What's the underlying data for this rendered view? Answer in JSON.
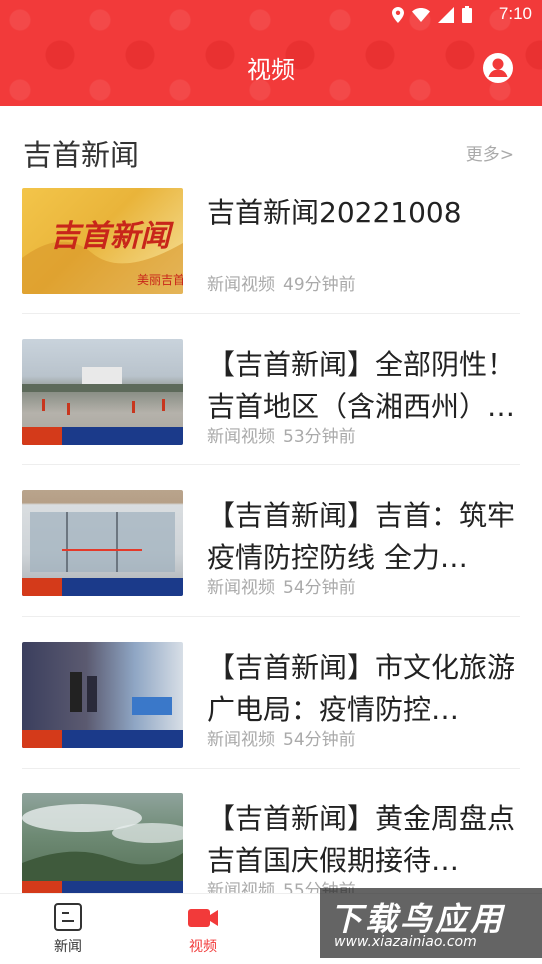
{
  "status_bar": {
    "time": "7:10"
  },
  "header": {
    "title": "视频"
  },
  "section": {
    "title": "吉首新闻",
    "more": "更多>"
  },
  "colors": {
    "accent": "#f23a3a",
    "muted": "#aaaaaa"
  },
  "news": [
    {
      "title": "吉首新闻20221008",
      "source": "新闻视频",
      "time": "49分钟前",
      "thumb": "news-logo-thumbnail"
    },
    {
      "title": "【吉首新闻】全部阴性！吉首地区（含湘西州）…",
      "source": "新闻视频",
      "time": "53分钟前",
      "thumb": "square-crowd-thumbnail"
    },
    {
      "title": "【吉首新闻】吉首：筑牢疫情防控防线 全力…",
      "source": "新闻视频",
      "time": "54分钟前",
      "thumb": "station-entrance-thumbnail"
    },
    {
      "title": "【吉首新闻】市文化旅游广电局：疫情防控…",
      "source": "新闻视频",
      "time": "54分钟前",
      "thumb": "checkpoint-thumbnail"
    },
    {
      "title": "【吉首新闻】黄金周盘点 吉首国庆假期接待…",
      "source": "新闻视频",
      "time": "55分钟前",
      "thumb": "aerial-landscape-thumbnail"
    }
  ],
  "bottom_nav": [
    {
      "label": "新闻",
      "icon": "news-icon",
      "active": false
    },
    {
      "label": "视频",
      "icon": "video-icon",
      "active": true
    }
  ],
  "watermark": {
    "main": "下载鸟应用",
    "sub": "www.xiazainiao.com"
  }
}
